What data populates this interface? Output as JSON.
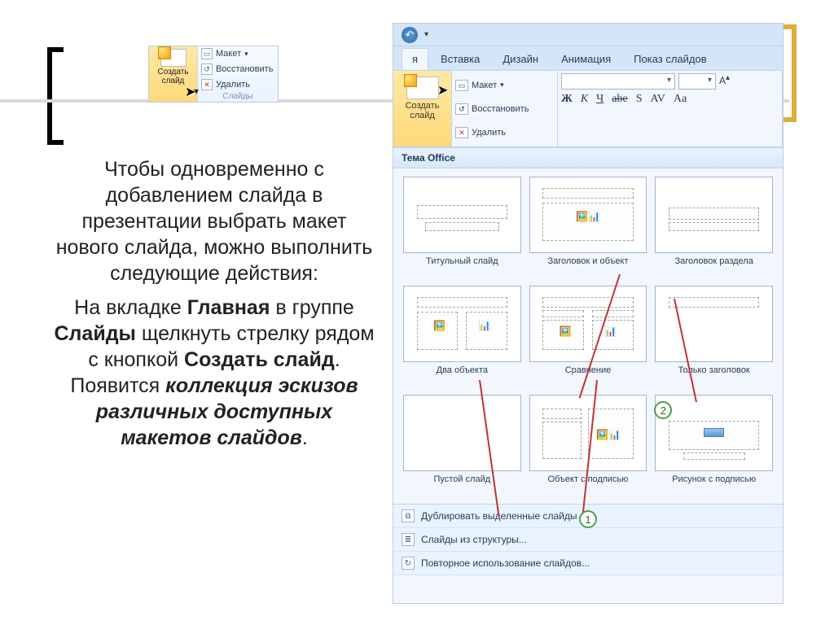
{
  "smallGroup": {
    "createLabel": "Создать\nслайд",
    "layout": "Макет",
    "reset": "Восстановить",
    "delete": "Удалить",
    "groupName": "Слайды"
  },
  "ribbon": {
    "tabs": [
      "я",
      "Вставка",
      "Дизайн",
      "Анимация",
      "Показ слайдов"
    ],
    "activeTab": 0,
    "createLabel": "Создать\nслайд",
    "layout": "Макет",
    "reset": "Восстановить",
    "delete": "Удалить",
    "fontButtons": [
      "Ж",
      "К",
      "Ч",
      "abe",
      "S",
      "AV",
      "Aa"
    ]
  },
  "gallery": {
    "header": "Тема Office",
    "items": [
      {
        "id": "title",
        "label": "Титульный слайд"
      },
      {
        "id": "title-content",
        "label": "Заголовок и объект"
      },
      {
        "id": "section",
        "label": "Заголовок раздела"
      },
      {
        "id": "two-content",
        "label": "Два объекта"
      },
      {
        "id": "comparison",
        "label": "Сравнение"
      },
      {
        "id": "title-only",
        "label": "Только заголовок"
      },
      {
        "id": "blank",
        "label": "Пустой слайд"
      },
      {
        "id": "content-caption",
        "label": "Объект с подписью"
      },
      {
        "id": "picture-caption",
        "label": "Рисунок с подписью"
      }
    ],
    "footer": [
      "Дублировать выделенные слайды",
      "Слайды из структуры...",
      "Повторное использование слайдов..."
    ]
  },
  "callouts": {
    "one": "1",
    "two": "2"
  },
  "bodyText": {
    "p1a": "Чтобы одновременно с добавлением слайда в презентации выбрать макет нового слайда, можно выполнить следующие действия:",
    "p2a": "На вкладке ",
    "p2b": "Главная",
    "p2c": " в группе ",
    "p2d": "Слайды",
    "p2e": " щелкнуть стрелку рядом с кнопкой ",
    "p2f": "Создать слайд",
    "p2g": ". Появится ",
    "p2h": "коллекция эскизов различных доступных макетов слайдов",
    "p2i": "."
  }
}
